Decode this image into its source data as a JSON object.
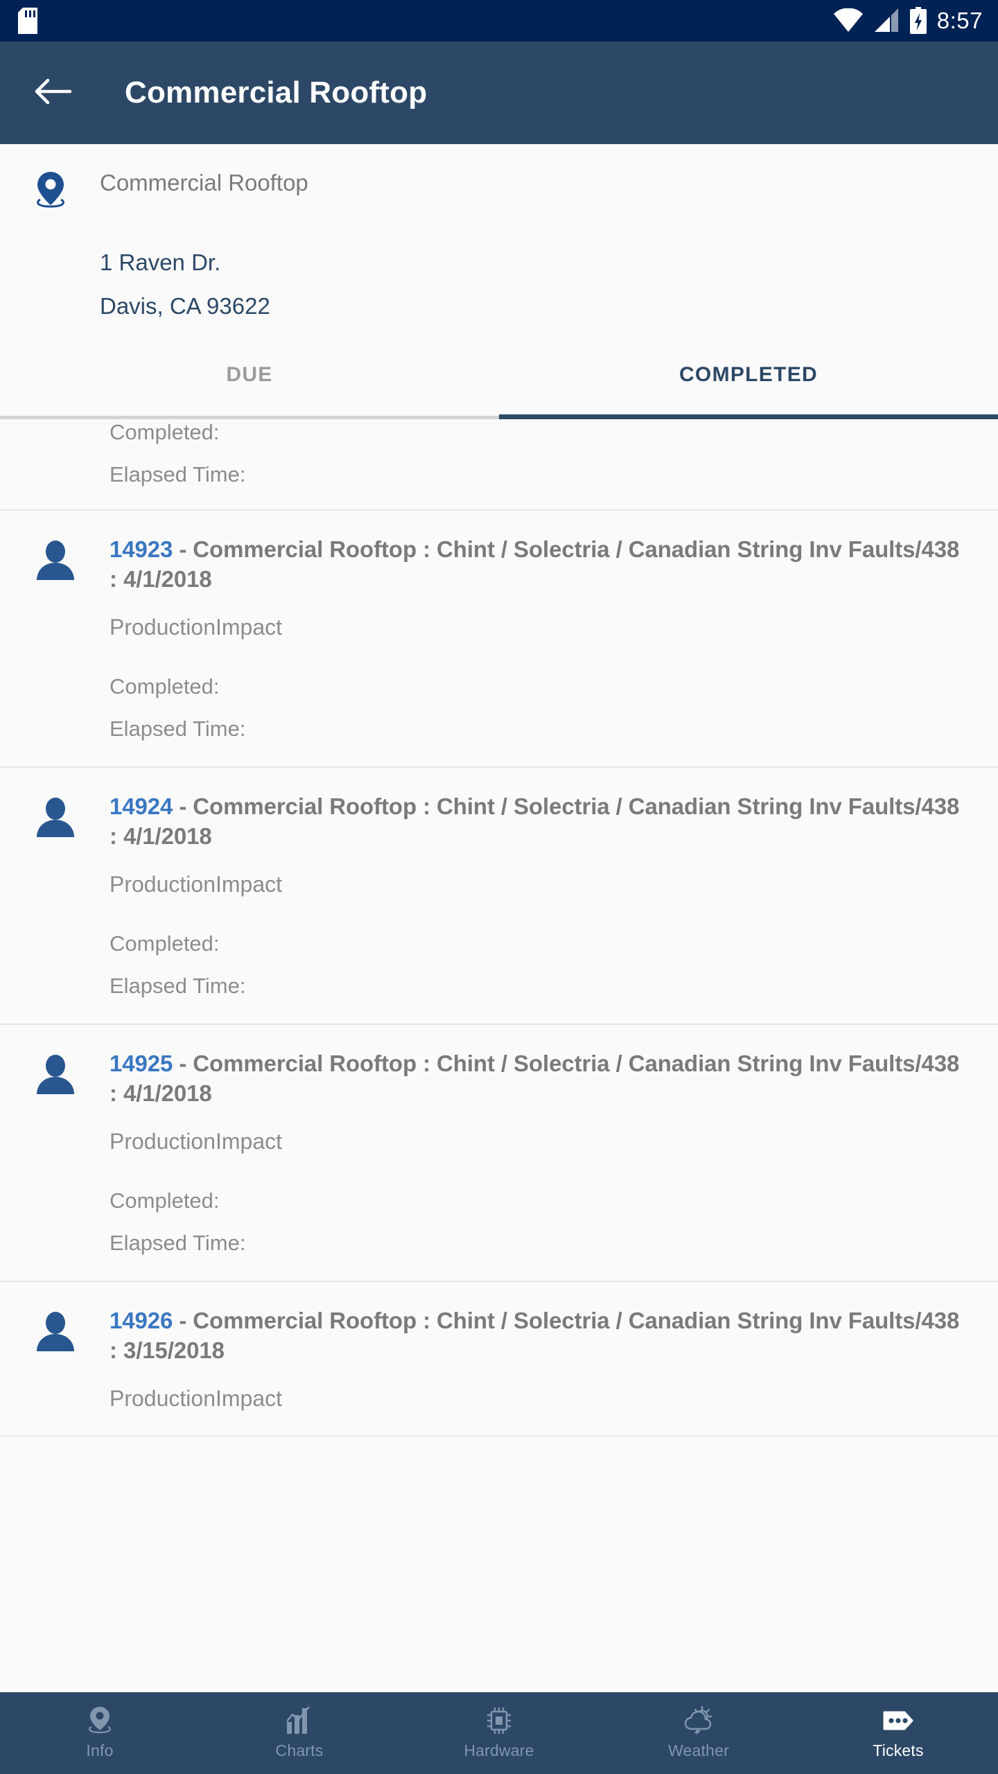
{
  "status_bar": {
    "time": "8:57",
    "icons": [
      "sd-card-icon",
      "wifi-icon",
      "cellular-signal-icon",
      "battery-charging-icon"
    ],
    "background": "#002255"
  },
  "app_bar": {
    "title": "Commercial Rooftop",
    "back_icon": "back-arrow-icon",
    "background": "#2c4866"
  },
  "site": {
    "pin_icon": "location-pin-icon",
    "name": "Commercial Rooftop",
    "address_line_1": "1 Raven Dr.",
    "address_line_2": "Davis, CA 93622",
    "name_color": "#7a7a7a",
    "address_color": "#2c4866"
  },
  "tabs": {
    "items": [
      {
        "label": "DUE",
        "active": false
      },
      {
        "label": "COMPLETED",
        "active": true
      }
    ],
    "active_color": "#2c4866",
    "inactive_color": "#9b9b9b"
  },
  "labels": {
    "completed": "Completed:",
    "elapsed_time": "Elapsed Time:"
  },
  "tickets": [
    {
      "partial": true,
      "id": "",
      "title": "",
      "impact": "",
      "completed": "Completed:",
      "elapsed": "Elapsed Time:"
    },
    {
      "partial": false,
      "id": "14923",
      "title": " - Commercial Rooftop : Chint / Solectria / Canadian String Inv Faults/438 : 4/1/2018",
      "impact": "ProductionImpact",
      "completed": "Completed:",
      "elapsed": "Elapsed Time:"
    },
    {
      "partial": false,
      "id": "14924",
      "title": " - Commercial Rooftop : Chint / Solectria / Canadian String Inv Faults/438 : 4/1/2018",
      "impact": "ProductionImpact",
      "completed": "Completed:",
      "elapsed": "Elapsed Time:"
    },
    {
      "partial": false,
      "id": "14925",
      "title": " - Commercial Rooftop : Chint / Solectria / Canadian String Inv Faults/438 : 4/1/2018",
      "impact": "ProductionImpact",
      "completed": "Completed:",
      "elapsed": "Elapsed Time:"
    },
    {
      "partial": false,
      "id": "14926",
      "title": " - Commercial Rooftop : Chint / Solectria / Canadian String Inv Faults/438 : 3/15/2018",
      "impact": "ProductionImpact",
      "completed": "",
      "elapsed": ""
    }
  ],
  "bottom_nav": {
    "items": [
      {
        "label": "Info",
        "icon": "location-pin-icon",
        "active": false
      },
      {
        "label": "Charts",
        "icon": "bar-chart-icon",
        "active": false
      },
      {
        "label": "Hardware",
        "icon": "chip-icon",
        "active": false
      },
      {
        "label": "Weather",
        "icon": "storm-cloud-icon",
        "active": false
      },
      {
        "label": "Tickets",
        "icon": "ticket-icon",
        "active": true
      }
    ],
    "background": "#2c4866",
    "active_color": "#ffffff",
    "inactive_color": "#8296ad"
  },
  "colors": {
    "ticket_id": "#3a77c2",
    "ticket_text": "#7a7a7a",
    "avatar": "#28568f",
    "page_background": "#fafafa",
    "divider": "#e6e6e6"
  }
}
